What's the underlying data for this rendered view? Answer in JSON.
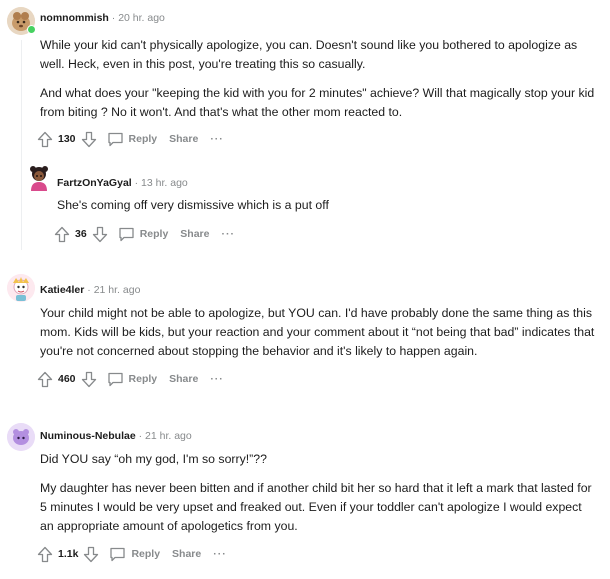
{
  "comments": [
    {
      "username": "nomnommish",
      "time": "20 hr. ago",
      "paragraphs": [
        "While your kid can't physically apologize, you can. Doesn't sound like you bothered to apologize as well. Heck, even in this post, you're treating this so casually.",
        "And what does your \"keeping the kid with you for 2 minutes\" achieve? Will that magically stop your kid from biting ? No it won't. And that's what the other mom reacted to."
      ],
      "score": "130",
      "avatar_color": "#c89b6a"
    },
    {
      "username": "FartzOnYaGyal",
      "time": "13 hr. ago",
      "paragraphs": [
        "She's coming off very dismissive which is a put off"
      ],
      "score": "36",
      "avatar_color": "#3b2a2a"
    },
    {
      "username": "Katie4ler",
      "time": "21 hr. ago",
      "paragraphs": [
        "Your child might not be able to apologize, but YOU can. I'd have probably done the same thing as this mom. Kids will be kids, but your reaction and your comment about it “not being that bad” indicates that you're not concerned about stopping the behavior and it's likely to happen again."
      ],
      "score": "460",
      "avatar_color": "#f4c9d6"
    },
    {
      "username": "Numinous-Nebulae",
      "time": "21 hr. ago",
      "paragraphs": [
        "Did YOU say “oh my god, I'm so sorry!”??",
        "My daughter has never been bitten and if another child bit her so hard that it left a mark that lasted for 5 minutes I would be very upset and freaked out. Even if your toddler can't apologize I would expect an appropriate amount of apologetics from you."
      ],
      "score": "1.1k",
      "avatar_color": "#c7a8e8"
    }
  ],
  "actions": {
    "reply": "Reply",
    "share": "Share",
    "more": "···",
    "separator": "·"
  },
  "icons": {
    "upvote": "upvote-icon",
    "downvote": "downvote-icon",
    "reply": "comment-bubble-icon"
  },
  "colors": {
    "text": "#1c1c1c",
    "meta": "#878a8c",
    "online": "#46d160"
  }
}
